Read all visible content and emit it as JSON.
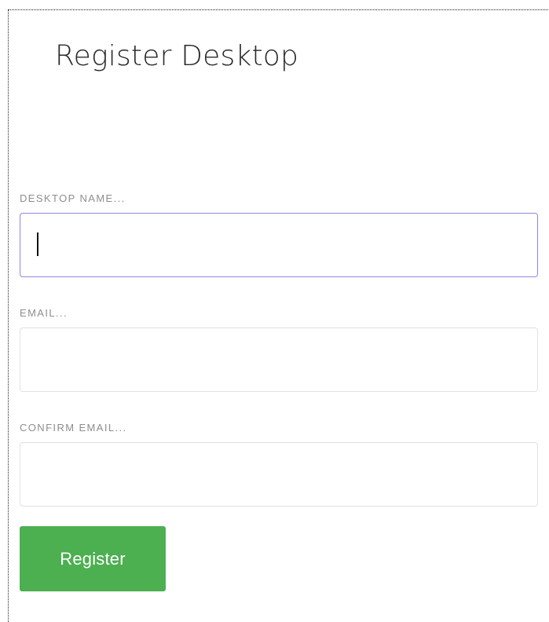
{
  "page": {
    "title": "Register Desktop"
  },
  "form": {
    "desktop_name": {
      "label": "DESKTOP NAME...",
      "value": "",
      "placeholder": ""
    },
    "email": {
      "label": "EMAIL...",
      "value": "",
      "placeholder": ""
    },
    "confirm_email": {
      "label": "CONFIRM EMAIL...",
      "value": "",
      "placeholder": ""
    },
    "submit_label": "Register"
  },
  "colors": {
    "focus_border": "#8f86e8",
    "button_bg": "#4caf50",
    "label_text": "#8e8e8e"
  }
}
